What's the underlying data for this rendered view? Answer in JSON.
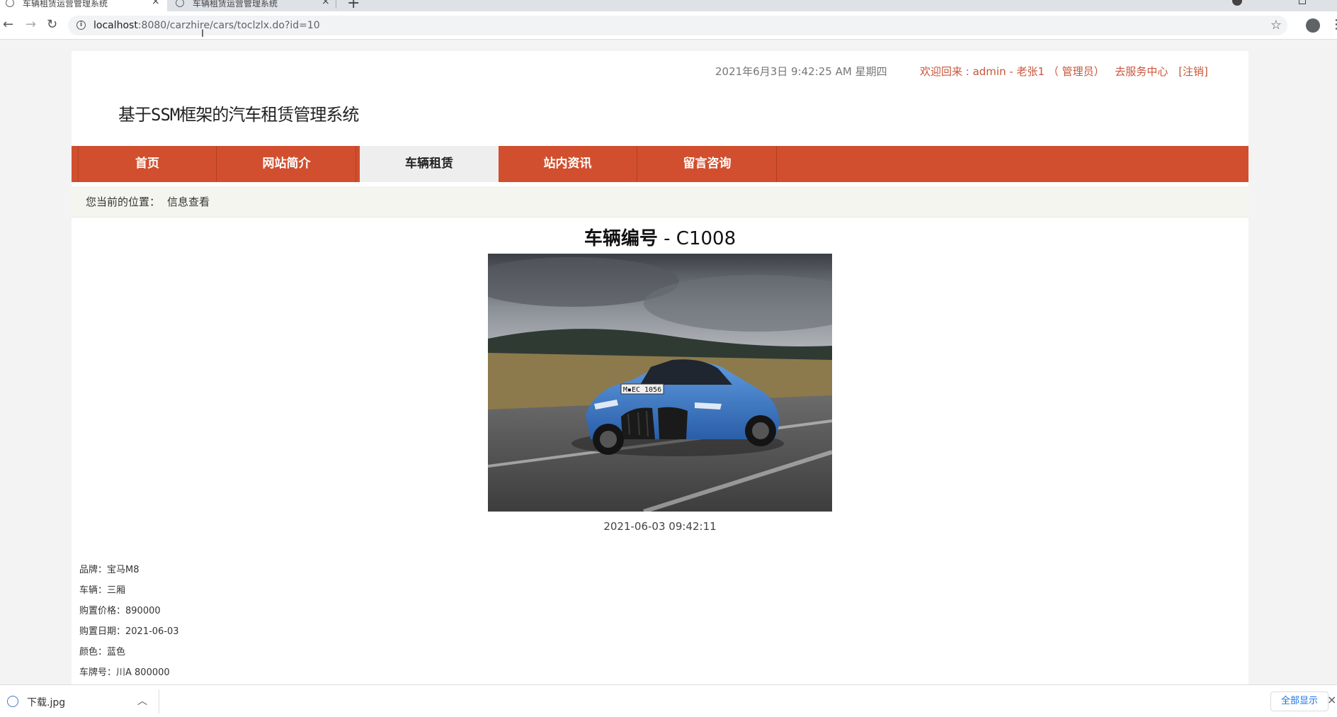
{
  "browser": {
    "tabs": [
      {
        "title": "车辆租赁运营管理系统",
        "active": true
      },
      {
        "title": "车辆租赁运营管理系统",
        "active": false
      }
    ],
    "url_host": "localhost",
    "url_rest": ":8080/carzhire/cars/toclzlx.do?id=10"
  },
  "header": {
    "datetime": "2021年6月3日 9:42:25 AM 星期四",
    "welcome": "欢迎回来 : admin - 老张1 （ 管理员）",
    "service_link": "去服务中心",
    "logout_link": "[注销]",
    "site_title": "基于SSM框架的汽车租赁管理系统"
  },
  "nav": {
    "items": [
      "首页",
      "网站简介",
      "车辆租赁",
      "站内资讯",
      "留言咨询"
    ],
    "active_index": 2
  },
  "breadcrumb": {
    "label": "您当前的位置：",
    "current": "信息查看"
  },
  "detail": {
    "title_label": "车辆编号",
    "title_sep": " - ",
    "car_code": "C1008",
    "plate_text": "M▪EC 1056",
    "post_time": "2021-06-03 09:42:11",
    "specs": [
      {
        "label": "品牌：",
        "value": "宝马M8"
      },
      {
        "label": "车辆：",
        "value": "三厢"
      },
      {
        "label": "购置价格：",
        "value": "890000"
      },
      {
        "label": "购置日期：",
        "value": "2021-06-03"
      },
      {
        "label": "颜色：",
        "value": "蓝色"
      },
      {
        "label": "车牌号：",
        "value": "川A 800000"
      }
    ]
  },
  "downloads": {
    "file_name": "下载.jpg",
    "show_all": "全部显示"
  },
  "colors": {
    "nav_bg": "#d14f2e",
    "accent_text": "#c9553a",
    "breadcrumb_bg": "#f5f5f0"
  }
}
